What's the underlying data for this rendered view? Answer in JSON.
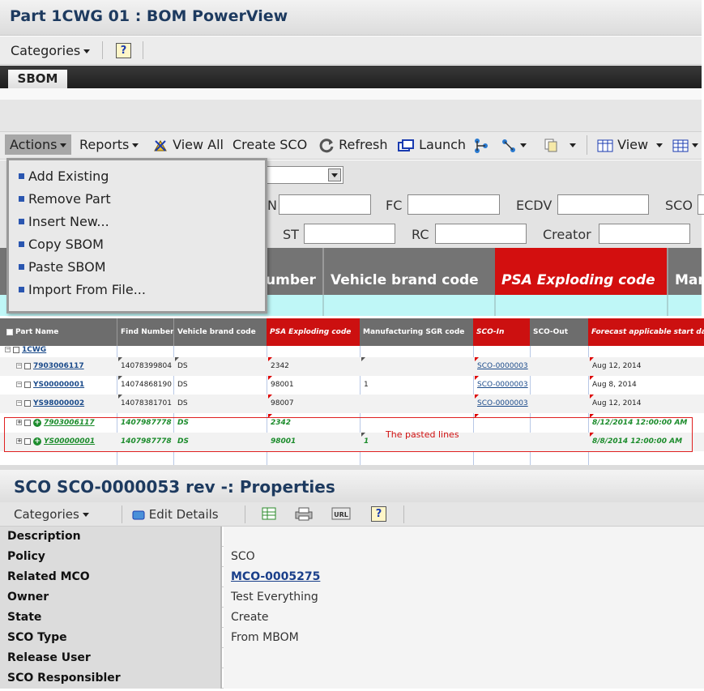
{
  "header": {
    "title": "Part 1CWG 01 : BOM PowerView"
  },
  "categories_bar": {
    "categories_label": "Categories",
    "help_glyph": "?"
  },
  "tabs": [
    {
      "label": "SBOM"
    }
  ],
  "toolbar": {
    "actions_label": "Actions",
    "reports_label": "Reports",
    "view_all_label": "View All",
    "create_sco_label": "Create SCO",
    "refresh_label": "Refresh",
    "launch_label": "Launch",
    "view_label": "View"
  },
  "actions_menu": {
    "items": [
      {
        "label": "Add Existing"
      },
      {
        "label": "Remove Part"
      },
      {
        "label": "Insert New..."
      },
      {
        "label": "Copy SBOM"
      },
      {
        "label": "Paste SBOM"
      },
      {
        "label": "Import From File..."
      }
    ]
  },
  "filters": {
    "n_label": "N",
    "fc_label": "FC",
    "ecdv_label": "ECDV",
    "sco_label": "SCO",
    "st_label": "ST",
    "rc_label": "RC",
    "creator_label": "Creator"
  },
  "big_header": {
    "find_number": "umber",
    "vehicle_brand_code": "Vehicle brand code",
    "psa_exploding_code": "PSA Exploding code",
    "manufacturing": "Man"
  },
  "table": {
    "columns": [
      "Part Name",
      "Find Number",
      "Vehicle brand code",
      "PSA Exploding code",
      "Manufacturing SGR code",
      "SCO-In",
      "SCO-Out",
      "Forecast applicable start date"
    ],
    "root": {
      "part_name": "1CWG"
    },
    "rows": [
      {
        "part_name": "7903006117",
        "find_number": "14078399804",
        "vehicle_brand": "DS",
        "psa_code": "2342",
        "mfg_sgr": "",
        "sco_in": "SCO-0000003",
        "sco_out": "",
        "start_date": "Aug 12, 2014"
      },
      {
        "part_name": "YS00000001",
        "find_number": "14074868190",
        "vehicle_brand": "DS",
        "psa_code": "98001",
        "mfg_sgr": "1",
        "sco_in": "SCO-0000003",
        "sco_out": "",
        "start_date": "Aug 8, 2014"
      },
      {
        "part_name": "YS98000002",
        "find_number": "14078381701",
        "vehicle_brand": "DS",
        "psa_code": "98007",
        "mfg_sgr": "",
        "sco_in": "SCO-0000003",
        "sco_out": "",
        "start_date": "Aug 12, 2014"
      }
    ],
    "pasted_rows": [
      {
        "part_name": "7903006117",
        "find_number": "1407987778",
        "vehicle_brand": "DS",
        "psa_code": "2342",
        "mfg_sgr": "",
        "sco_in": "",
        "sco_out": "",
        "start_date": "8/12/2014 12:00:00 AM"
      },
      {
        "part_name": "YS00000001",
        "find_number": "1407987778",
        "vehicle_brand": "DS",
        "psa_code": "98001",
        "mfg_sgr": "1",
        "sco_in": "",
        "sco_out": "",
        "start_date": "8/8/2014 12:00:00 AM"
      }
    ],
    "pasted_note": "The pasted lines"
  },
  "properties": {
    "title": "SCO SCO-0000053 rev -: Properties",
    "toolbar": {
      "categories_label": "Categories",
      "edit_details_label": "Edit Details",
      "help_glyph": "?",
      "url_glyph": "URL"
    },
    "rows": [
      {
        "key": "Description",
        "value": ""
      },
      {
        "key": "Policy",
        "value": "SCO"
      },
      {
        "key": "Related MCO",
        "value": "MCO-0005275"
      },
      {
        "key": "Owner",
        "value": "Test Everything"
      },
      {
        "key": "State",
        "value": "Create"
      },
      {
        "key": "SCO Type",
        "value": "From MBOM"
      },
      {
        "key": "Release User",
        "value": ""
      },
      {
        "key": "SCO Responsibler",
        "value": ""
      }
    ]
  },
  "colors": {
    "title_text": "#1d3a5f",
    "psa_header_red": "#d30f0f",
    "pasted_green": "#1c8c2c",
    "cyan_band": "#bff7f7",
    "link_blue": "#1a4a8a"
  }
}
